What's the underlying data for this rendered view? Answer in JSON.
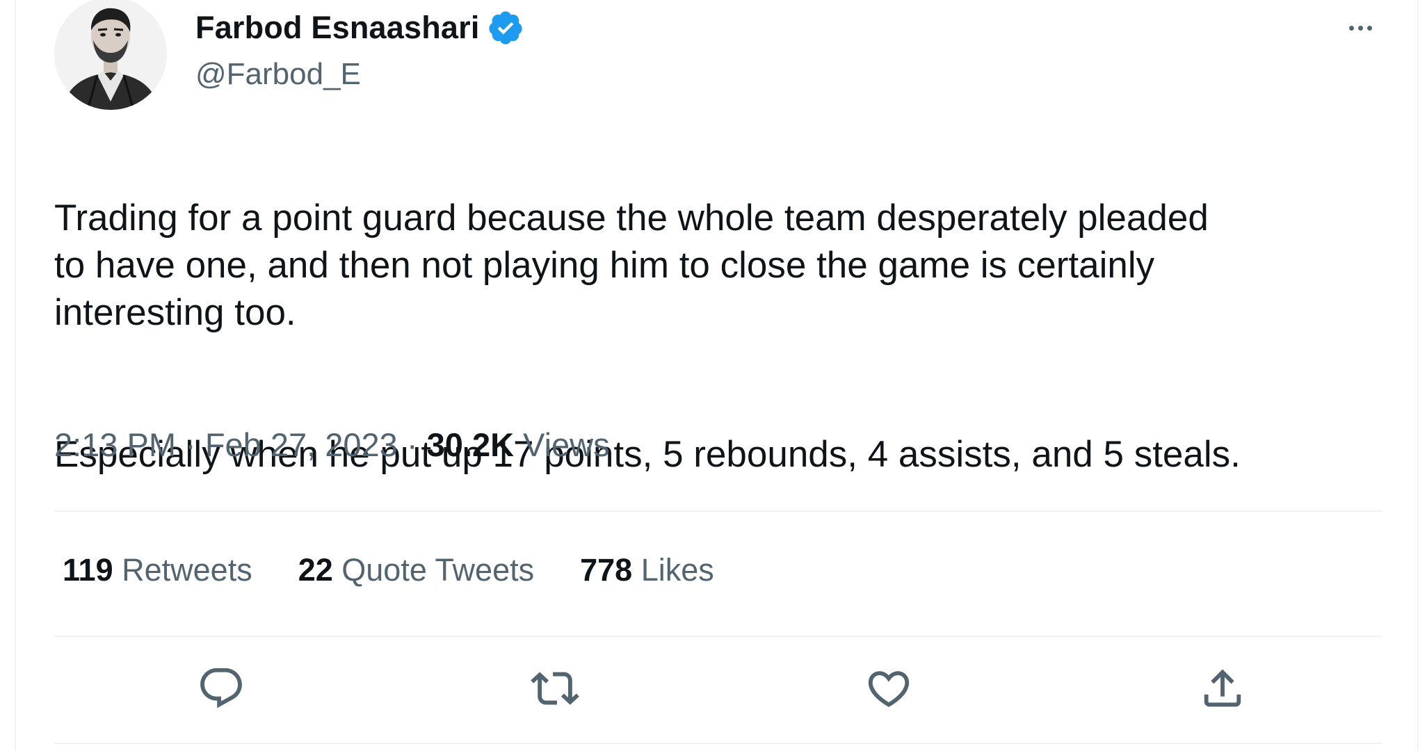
{
  "author": {
    "display_name": "Farbod Esnaashari",
    "handle": "@Farbod_E",
    "verified": true,
    "avatar_icon": "profile-photo"
  },
  "menu": {
    "more_icon": "more-horizontal-icon"
  },
  "tweet": {
    "paragraph_1": "Trading for a point guard because the whole team desperately pleaded\nto have one, and then not playing him to close the game is certainly\ninteresting too.",
    "paragraph_2": "Especially when he put up 17 points, 5 rebounds, 4 assists, and 5 steals."
  },
  "meta": {
    "time": "2:13 PM",
    "separator_1": " · ",
    "date": "Feb 27, 2023",
    "separator_2": " · ",
    "views_count": "30.2K",
    "views_label": " Views"
  },
  "stats": {
    "retweets_count": "119",
    "retweets_label": " Retweets",
    "quotes_count": "22",
    "quotes_label": " Quote Tweets",
    "likes_count": "778",
    "likes_label": " Likes"
  },
  "actions": [
    {
      "icon": "reply-icon"
    },
    {
      "icon": "retweet-icon"
    },
    {
      "icon": "like-icon"
    },
    {
      "icon": "share-icon"
    }
  ],
  "colors": {
    "primary_text": "#0f1419",
    "secondary_text": "#536471",
    "divider": "#eff3f4",
    "verified_blue": "#1d9bf0"
  }
}
